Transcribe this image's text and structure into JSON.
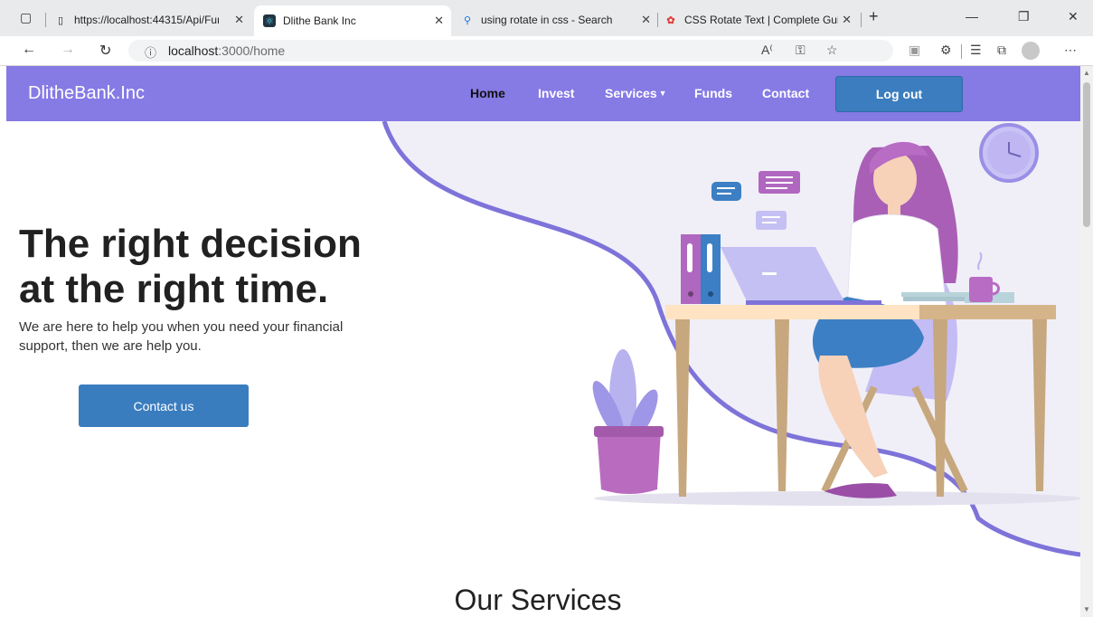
{
  "browser": {
    "tabs": [
      {
        "title": "https://localhost:44315/Api/Func"
      },
      {
        "title": "Dlithe Bank Inc"
      },
      {
        "title": "using rotate in css - Search"
      },
      {
        "title": "CSS Rotate Text | Complete Guid"
      }
    ],
    "url_host": "localhost",
    "url_path": ":3000/home"
  },
  "nav": {
    "brand": "DlitheBank.Inc",
    "links": [
      "Home",
      "Invest",
      "Services",
      "Funds",
      "Contact"
    ],
    "logout": "Log out"
  },
  "hero": {
    "headline": "The right decision at the right time.",
    "subtext": "We are here to help you when you need your financial support, then we are help you.",
    "cta": "Contact us"
  },
  "services": {
    "heading": "Our Services"
  },
  "colors": {
    "navbar": "#867ae5",
    "button_blue": "#3b7dbf",
    "accent_purple": "#7e73d9"
  }
}
